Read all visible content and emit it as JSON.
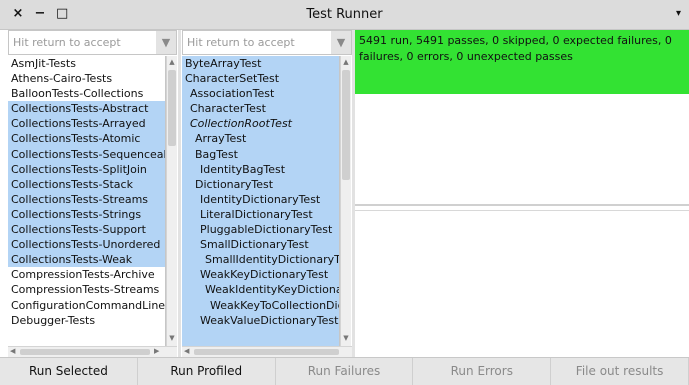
{
  "window": {
    "title": "Test Runner",
    "close": "×",
    "minimize": "−",
    "maximize": "□",
    "menu_arrow": "▾"
  },
  "packages": {
    "filter_placeholder": "Hit return to accept",
    "items": [
      {
        "label": "AsmJit-Tests",
        "selected": false
      },
      {
        "label": "Athens-Cairo-Tests",
        "selected": false
      },
      {
        "label": "BalloonTests-Collections",
        "selected": false
      },
      {
        "label": "CollectionsTests-Abstract",
        "selected": true
      },
      {
        "label": "CollectionsTests-Arrayed",
        "selected": true
      },
      {
        "label": "CollectionsTests-Atomic",
        "selected": true
      },
      {
        "label": "CollectionsTests-Sequenceab",
        "selected": true
      },
      {
        "label": "CollectionsTests-SplitJoin",
        "selected": true
      },
      {
        "label": "CollectionsTests-Stack",
        "selected": true
      },
      {
        "label": "CollectionsTests-Streams",
        "selected": true
      },
      {
        "label": "CollectionsTests-Strings",
        "selected": true
      },
      {
        "label": "CollectionsTests-Support",
        "selected": true
      },
      {
        "label": "CollectionsTests-Unordered",
        "selected": true
      },
      {
        "label": "CollectionsTests-Weak",
        "selected": true
      },
      {
        "label": "CompressionTests-Archive",
        "selected": false
      },
      {
        "label": "CompressionTests-Streams",
        "selected": false
      },
      {
        "label": "ConfigurationCommandLineH",
        "selected": false
      },
      {
        "label": "Debugger-Tests",
        "selected": false
      }
    ]
  },
  "classes": {
    "filter_placeholder": "Hit return to accept",
    "items": [
      {
        "label": "ByteArrayTest",
        "indent": 0,
        "italic": false
      },
      {
        "label": "CharacterSetTest",
        "indent": 0,
        "italic": false
      },
      {
        "label": "AssociationTest",
        "indent": 1,
        "italic": false
      },
      {
        "label": "CharacterTest",
        "indent": 1,
        "italic": false
      },
      {
        "label": "CollectionRootTest",
        "indent": 1,
        "italic": true
      },
      {
        "label": "ArrayTest",
        "indent": 2,
        "italic": false
      },
      {
        "label": "BagTest",
        "indent": 2,
        "italic": false
      },
      {
        "label": "IdentityBagTest",
        "indent": 3,
        "italic": false
      },
      {
        "label": "DictionaryTest",
        "indent": 2,
        "italic": false
      },
      {
        "label": "IdentityDictionaryTest",
        "indent": 3,
        "italic": false
      },
      {
        "label": "LiteralDictionaryTest",
        "indent": 3,
        "italic": false
      },
      {
        "label": "PluggableDictionaryTest",
        "indent": 3,
        "italic": false
      },
      {
        "label": "SmallDictionaryTest",
        "indent": 3,
        "italic": false
      },
      {
        "label": "SmallIdentityDictionaryTe",
        "indent": 4,
        "italic": false
      },
      {
        "label": "WeakKeyDictionaryTest",
        "indent": 3,
        "italic": false
      },
      {
        "label": "WeakIdentityKeyDictionar",
        "indent": 4,
        "italic": false
      },
      {
        "label": "WeakKeyToCollectionDic",
        "indent": 5,
        "italic": false
      },
      {
        "label": "WeakValueDictionaryTest",
        "indent": 3,
        "italic": false
      }
    ]
  },
  "result": {
    "text": "5491 run, 5491 passes, 0 skipped, 0 expected failures, 0 failures, 0 errors, 0 unexpected passes",
    "color": "#33e233"
  },
  "buttons": [
    {
      "label": "Run Selected",
      "enabled": true
    },
    {
      "label": "Run Profiled",
      "enabled": true
    },
    {
      "label": "Run Failures",
      "enabled": false
    },
    {
      "label": "Run Errors",
      "enabled": false
    },
    {
      "label": "File out results",
      "enabled": false
    }
  ]
}
